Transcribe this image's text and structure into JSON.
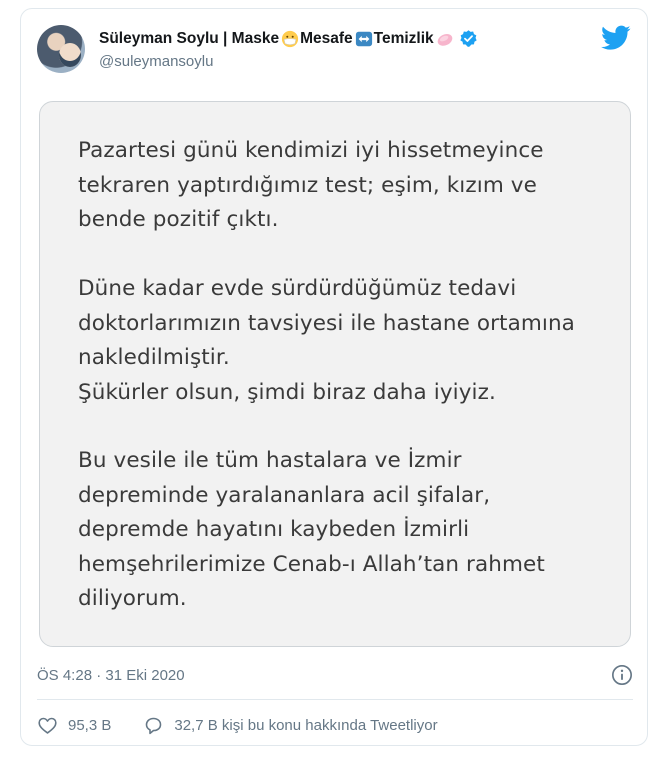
{
  "tweet": {
    "display_name": "Süleyman Soylu | Maske",
    "name_part2": "Mesafe",
    "name_part3": "Temizlik",
    "handle": "@suleymansoylu",
    "image_text": {
      "paragraph1": "Pazartesi günü kendimizi iyi hissetmeyince\ntekraren yaptırdığımız test; eşim, kızım ve\nbende pozitif çıktı.",
      "paragraph2": "Düne kadar evde sürdürdüğümüz tedavi\ndoktorlarımızın tavsiyesi ile hastane ortamına\nnakledilmiştir.\nŞükürler olsun, şimdi biraz daha iyiyiz.",
      "paragraph3": "Bu vesile ile tüm hastalara ve İzmir\ndepreminde yaralananlara acil şifalar,\ndepremde hayatını kaybeden İzmirli\nhemşehrilerimize Cenab-ı Allah’tan rahmet\ndiliyorum."
    },
    "timestamp": "ÖS 4:28 · 31 Eki 2020",
    "likes": "95,3 B",
    "conversation": "32,7 B kişi bu konu hakkında Tweetliyor"
  },
  "icons": [
    "twitter-bird-icon",
    "verified-badge-icon",
    "mask-emoji-icon",
    "left-right-arrow-emoji-icon",
    "soap-emoji-icon",
    "info-icon",
    "heart-icon",
    "comment-icon"
  ],
  "colors": {
    "twitter_blue": "#1da1f2",
    "secondary_text": "#657786",
    "primary_text": "#14171a",
    "image_text": "#3a3a3a",
    "image_background": "#f2f2f2"
  }
}
